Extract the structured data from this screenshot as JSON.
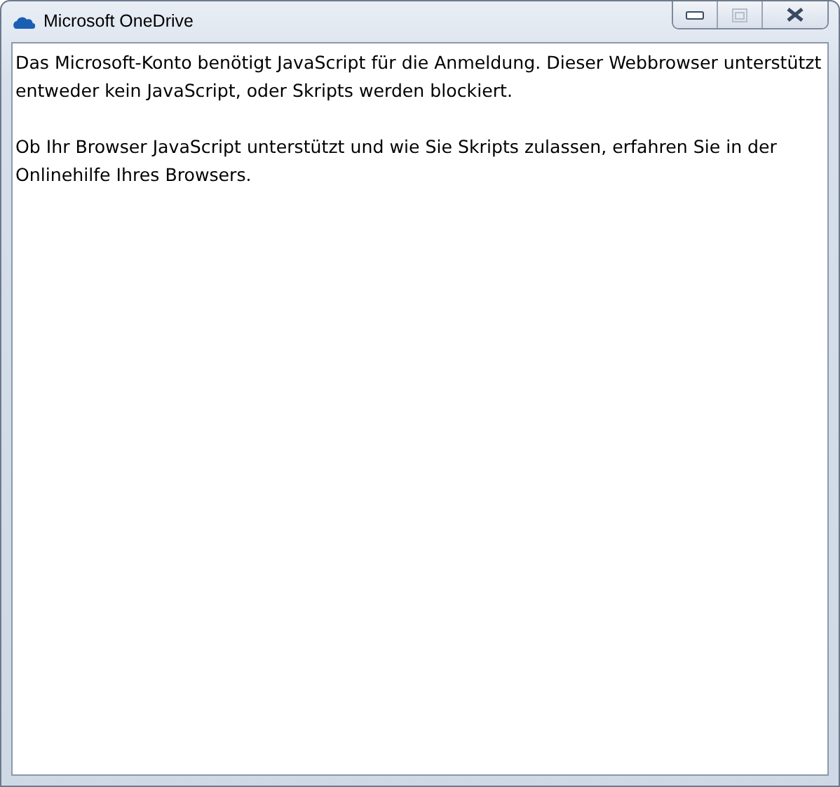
{
  "window": {
    "title": "Microsoft OneDrive",
    "buttons": [
      {
        "kind": "minimize",
        "disabled": false
      },
      {
        "kind": "maximize",
        "disabled": true
      },
      {
        "kind": "close",
        "disabled": false
      }
    ]
  },
  "paragraphs": [
    "Das Microsoft-Konto benötigt JavaScript für die Anmeldung. Dieser Webbrowser unterstützt entweder kein JavaScript, oder Skripts werden blockiert.",
    "Ob Ihr Browser JavaScript unterstützt und wie Sie Skripts zulassen, erfahren Sie in der Onlinehilfe Ihres Browsers."
  ]
}
